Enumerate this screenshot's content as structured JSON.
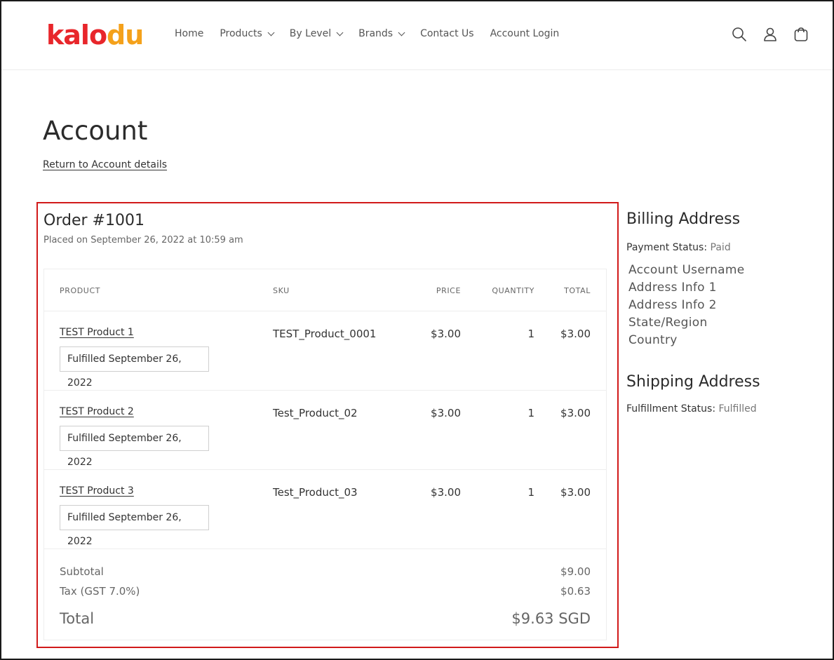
{
  "header": {
    "logo_part1": "kalo",
    "logo_part2": "du",
    "nav": [
      {
        "label": "Home"
      },
      {
        "label": "Products"
      },
      {
        "label": "By Level"
      },
      {
        "label": "Brands"
      },
      {
        "label": "Contact Us"
      },
      {
        "label": "Account Login"
      }
    ],
    "icons": [
      "search-icon",
      "account-icon",
      "cart-icon"
    ]
  },
  "page": {
    "title": "Account",
    "return_link": "Return to Account details"
  },
  "order": {
    "title": "Order #1001",
    "placed": "Placed on September 26, 2022 at 10:59 am",
    "columns": [
      "PRODUCT",
      "SKU",
      "PRICE",
      "QUANTITY",
      "TOTAL"
    ],
    "items": [
      {
        "product": "TEST Product 1",
        "fulfilled": "Fulfilled September 26, 2022",
        "sku": "TEST_Product_0001",
        "price": "$3.00",
        "quantity": "1",
        "total": "$3.00"
      },
      {
        "product": "TEST Product 2",
        "fulfilled": "Fulfilled September 26, 2022",
        "sku": "Test_Product_02",
        "price": "$3.00",
        "quantity": "1",
        "total": "$3.00"
      },
      {
        "product": "TEST Product 3",
        "fulfilled": "Fulfilled September 26, 2022",
        "sku": "Test_Product_03",
        "price": "$3.00",
        "quantity": "1",
        "total": "$3.00"
      }
    ],
    "subtotal_label": "Subtotal",
    "subtotal_value": "$9.00",
    "tax_label": "Tax (GST 7.0%)",
    "tax_value": "$0.63",
    "total_label": "Total",
    "total_value": "$9.63 SGD"
  },
  "billing": {
    "title": "Billing Address",
    "payment_status_label": "Payment Status:",
    "payment_status_value": "Paid",
    "address_lines": [
      "Account Username",
      "Address Info 1",
      "Address Info 2",
      "State/Region",
      "Country"
    ]
  },
  "shipping": {
    "title": "Shipping Address",
    "fulfillment_status_label": "Fulfillment Status:",
    "fulfillment_status_value": "Fulfilled"
  },
  "colors": {
    "logo_red": "#e8262b",
    "logo_orange": "#f4a11b",
    "highlight_border": "#d11a1a"
  }
}
